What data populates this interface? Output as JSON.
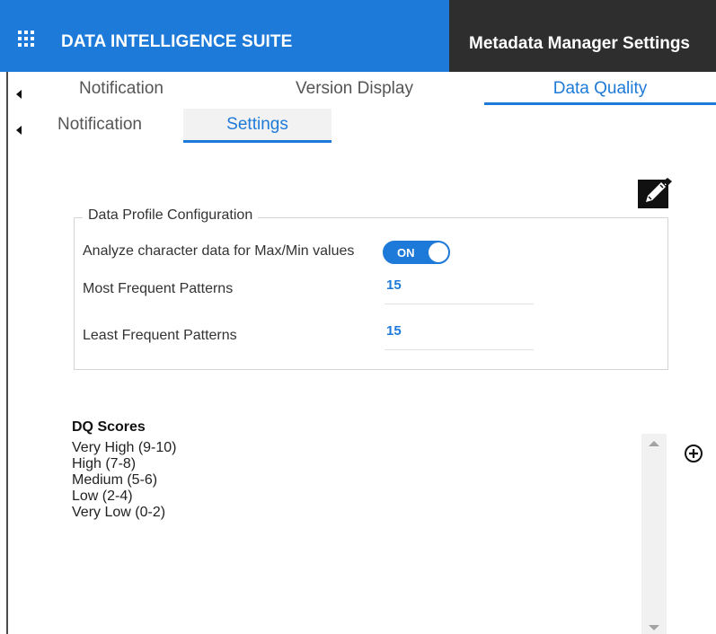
{
  "header": {
    "app_title": "DATA INTELLIGENCE SUITE",
    "context_title": "Metadata Manager Settings",
    "brand_color": "#1e7ad8",
    "context_color": "#2e2e2e"
  },
  "tabs_primary": [
    {
      "label": "Notification",
      "active": false
    },
    {
      "label": "Version Display",
      "active": false
    },
    {
      "label": "Data Quality",
      "active": true
    }
  ],
  "tabs_secondary": [
    {
      "label": "Notification",
      "active": false
    },
    {
      "label": "Settings",
      "active": true
    }
  ],
  "data_profile": {
    "legend": "Data Profile Configuration",
    "analyze_label": "Analyze character data for Max/Min values",
    "analyze_toggle": "ON",
    "most_frequent_label": "Most Frequent Patterns",
    "most_frequent_value": "15",
    "least_frequent_label": "Least Frequent Patterns",
    "least_frequent_value": "15"
  },
  "dq_scores": {
    "title": "DQ Scores",
    "items": [
      "Very High (9-10)",
      "High (7-8)",
      "Medium (5-6)",
      "Low (2-4)",
      "Very Low (0-2)"
    ]
  },
  "icons": {
    "menu": "grid-icon",
    "edit": "pencil-icon",
    "add": "plus-circle-icon",
    "collapse": "caret-left-icon"
  }
}
